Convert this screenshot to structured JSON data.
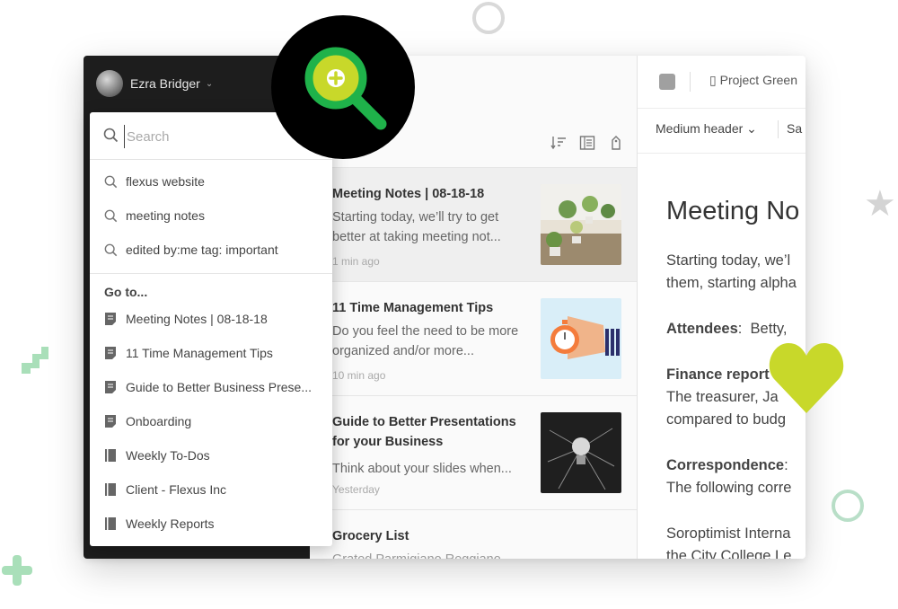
{
  "user": {
    "name": "Ezra Bridger"
  },
  "search": {
    "placeholder": "Search"
  },
  "suggestions": [
    {
      "label": "flexus website"
    },
    {
      "label": "meeting notes"
    },
    {
      "label": "edited by:me tag: important"
    }
  ],
  "goto": {
    "heading": "Go to...",
    "items": [
      {
        "label": "Meeting Notes | 08-18-18",
        "icon": "note-icon"
      },
      {
        "label": "11 Time Management Tips",
        "icon": "note-icon"
      },
      {
        "label": "Guide to Better Business Prese...",
        "icon": "note-icon"
      },
      {
        "label": "Onboarding",
        "icon": "note-icon"
      },
      {
        "label": "Weekly To-Dos",
        "icon": "notebook-icon"
      },
      {
        "label": "Client - Flexus Inc",
        "icon": "notebook-icon"
      },
      {
        "label": "Weekly Reports",
        "icon": "notebook-icon"
      }
    ]
  },
  "notes": [
    {
      "title": "Meeting Notes | 08-18-18",
      "snippet": "Starting today, we’ll try to get better at taking meeting not...",
      "time": "1 min ago"
    },
    {
      "title": "11 Time Management Tips",
      "snippet": "Do you feel the need to be more organized and/or more...",
      "time": "10 min ago"
    },
    {
      "title": "Guide to Better Presentations for your Business",
      "snippet": "Think about your slides when...",
      "time": "Yesterday"
    },
    {
      "title": "Grocery List",
      "snippet": "Grated Parmigiano Reggiano Baking Soda"
    }
  ],
  "editor": {
    "notebook": "Project Green",
    "format_header": "Medium header",
    "format_font": "Sa",
    "doc_title": "Meeting No",
    "lines": [
      "Starting today, we’l",
      "them, starting alpha",
      "Betty,",
      "The treasurer, Ja",
      "compared to budg",
      "The following corre",
      "Soroptimist Interna",
      "the City College Le"
    ],
    "labels": {
      "attendees": "Attendees",
      "finance": "Finance report",
      "correspondence": "Correspondence"
    }
  },
  "colors": {
    "accent_green": "#c8d82a",
    "sidebar_dark": "#1d1d1d"
  }
}
